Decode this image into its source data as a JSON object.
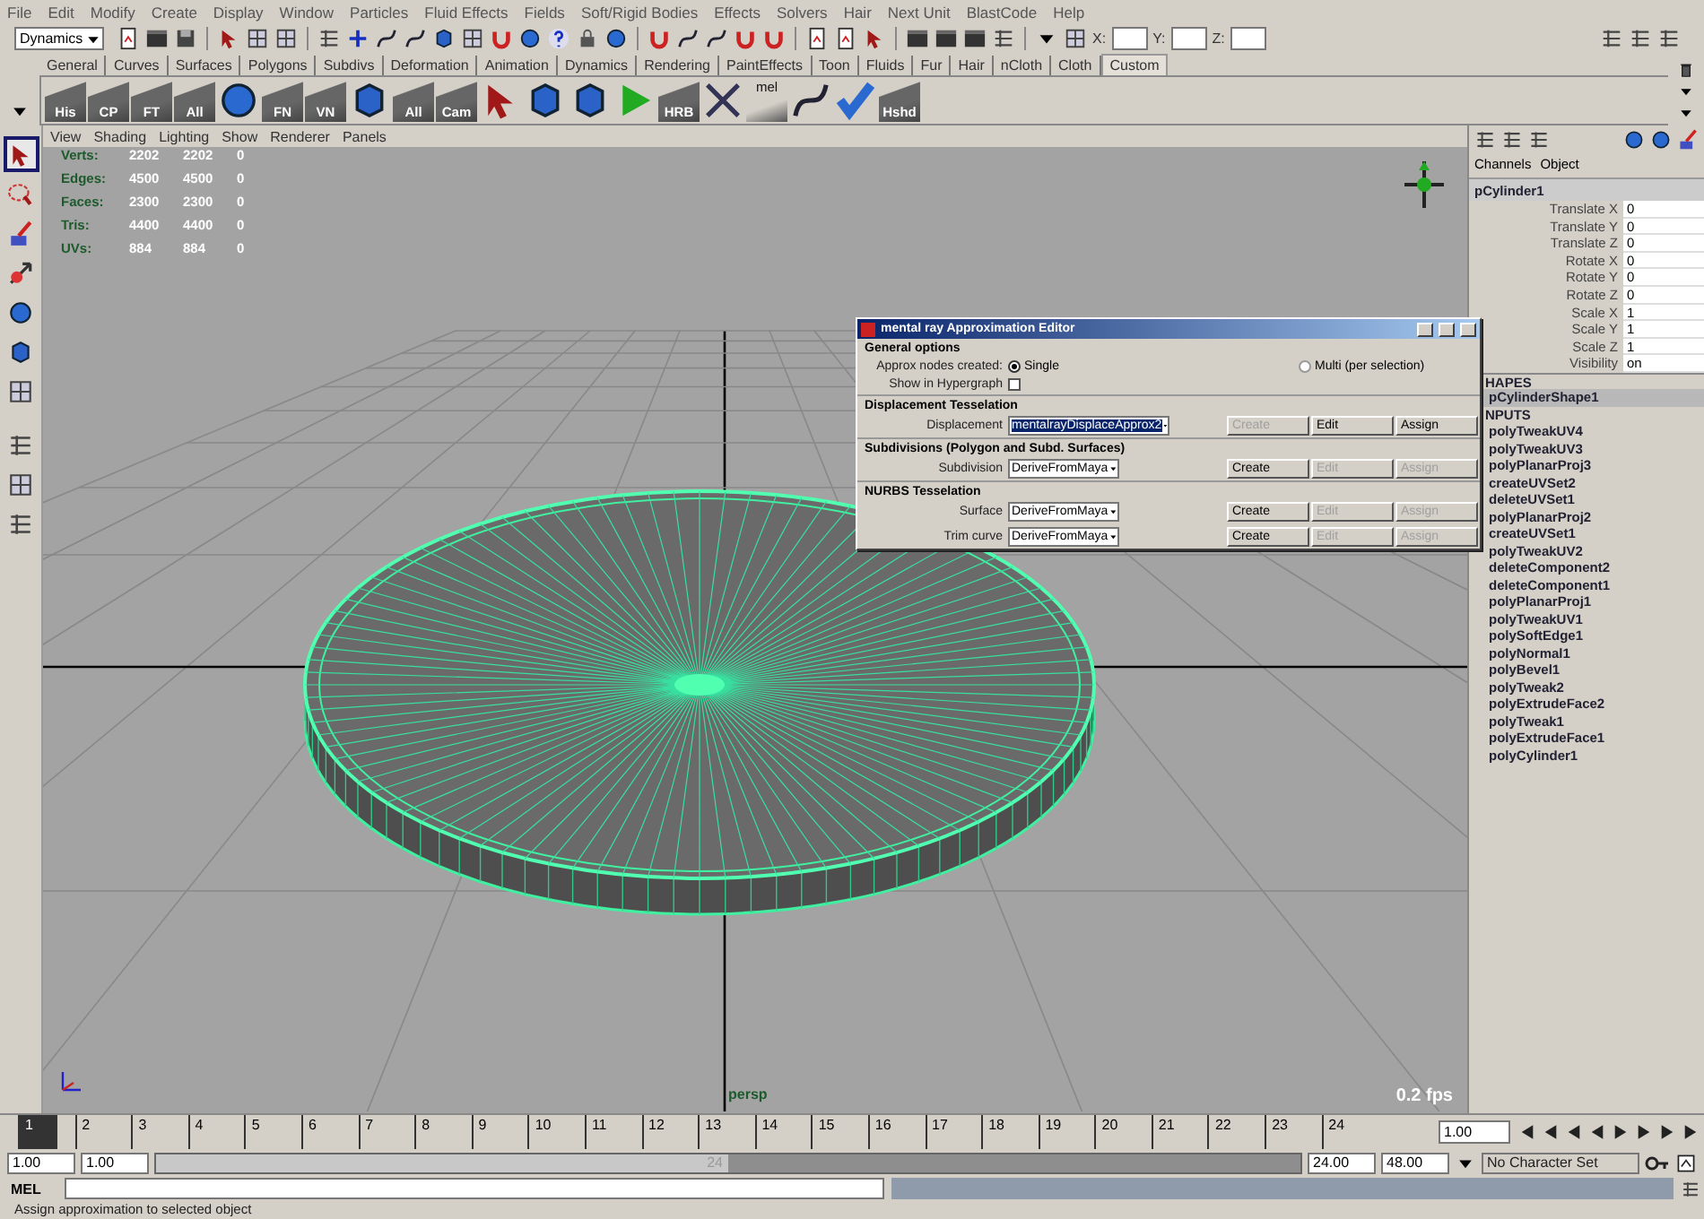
{
  "menu_bar": [
    "File",
    "Edit",
    "Modify",
    "Create",
    "Display",
    "Window",
    "Particles",
    "Fluid Effects",
    "Fields",
    "Soft/Rigid Bodies",
    "Effects",
    "Solvers",
    "Hair",
    "Next Unit",
    "BlastCode",
    "Help"
  ],
  "status_line": {
    "mode": "Dynamics",
    "fields": [
      {
        "label": "X:"
      },
      {
        "label": "Y:"
      },
      {
        "label": "Z:"
      }
    ]
  },
  "shelf": {
    "tabs": [
      {
        "label": "General",
        "selected": false
      },
      {
        "label": "Curves",
        "selected": false
      },
      {
        "label": "Surfaces",
        "selected": false
      },
      {
        "label": "Polygons",
        "selected": false
      },
      {
        "label": "Subdivs",
        "selected": false
      },
      {
        "label": "Deformation",
        "selected": false
      },
      {
        "label": "Animation",
        "selected": false
      },
      {
        "label": "Dynamics",
        "selected": false
      },
      {
        "label": "Rendering",
        "selected": false
      },
      {
        "label": "PaintEffects",
        "selected": false
      },
      {
        "label": "Toon",
        "selected": false
      },
      {
        "label": "Fluids",
        "selected": false
      },
      {
        "label": "Fur",
        "selected": false
      },
      {
        "label": "Hair",
        "selected": false
      },
      {
        "label": "nCloth",
        "selected": false
      },
      {
        "label": "Cloth",
        "selected": false
      },
      {
        "label": "Custom",
        "selected": true
      }
    ],
    "buttons": [
      {
        "kind": "labeled",
        "label": "His"
      },
      {
        "kind": "labeled",
        "label": "CP"
      },
      {
        "kind": "labeled",
        "label": "FT"
      },
      {
        "kind": "labeled",
        "label": "All"
      },
      {
        "kind": "icon"
      },
      {
        "kind": "labeled",
        "label": "FN"
      },
      {
        "kind": "labeled",
        "label": "VN"
      },
      {
        "kind": "icon"
      },
      {
        "kind": "labeled",
        "label": "All"
      },
      {
        "kind": "labeled",
        "label": "Cam"
      },
      {
        "kind": "icon"
      },
      {
        "kind": "icon"
      },
      {
        "kind": "icon"
      },
      {
        "kind": "icon"
      },
      {
        "kind": "labeled",
        "label": "HRB"
      },
      {
        "kind": "icon"
      },
      {
        "kind": "labeled",
        "label": "mel"
      },
      {
        "kind": "icon"
      },
      {
        "kind": "icon"
      },
      {
        "kind": "labeled",
        "label": "Hshd"
      }
    ]
  },
  "toolbox": [
    {
      "selected": true
    },
    {
      "selected": false
    },
    {
      "selected": false
    },
    {
      "selected": false
    },
    {
      "selected": false
    },
    {
      "selected": false
    },
    {
      "selected": false
    },
    {
      "selected": false
    },
    {
      "selected": false
    },
    {
      "selected": false
    }
  ],
  "viewport": {
    "panel_menu": [
      "View",
      "Shading",
      "Lighting",
      "Show",
      "Renderer",
      "Panels"
    ],
    "hud": [
      {
        "label": "Verts:",
        "values": [
          "2202",
          "2202",
          "0"
        ]
      },
      {
        "label": "Edges:",
        "values": [
          "4500",
          "4500",
          "0"
        ]
      },
      {
        "label": "Faces:",
        "values": [
          "2300",
          "2300",
          "0"
        ]
      },
      {
        "label": "Tris:",
        "values": [
          "4400",
          "4400",
          "0"
        ]
      },
      {
        "label": "UVs:",
        "values": [
          "884",
          "884",
          "0"
        ]
      }
    ],
    "camera": "persp",
    "fps": "0.2 fps"
  },
  "approximation_editor": {
    "title": "mental ray Approximation Editor",
    "general": {
      "heading": "General options",
      "approx_label": "Approx nodes created:",
      "options": [
        {
          "label": "Single",
          "selected": true
        },
        {
          "label": "Multi (per selection)",
          "selected": false
        }
      ],
      "hypergraph": {
        "label": "Show in Hypergraph",
        "checked": false
      }
    },
    "groups": [
      {
        "heading": "Displacement Tesselation",
        "rows": [
          {
            "label": "Displacement",
            "value": "mentalrayDisplaceApprox2",
            "highlighted": true,
            "buttons": [
              {
                "label": "Create",
                "disabled": true
              },
              {
                "label": "Edit",
                "disabled": false
              },
              {
                "label": "Assign",
                "disabled": false
              }
            ]
          }
        ]
      },
      {
        "heading": "Subdivisions (Polygon and Subd. Surfaces)",
        "rows": [
          {
            "label": "Subdivision",
            "value": "DeriveFromMaya",
            "highlighted": false,
            "buttons": [
              {
                "label": "Create",
                "disabled": false
              },
              {
                "label": "Edit",
                "disabled": true
              },
              {
                "label": "Assign",
                "disabled": true
              }
            ]
          }
        ]
      },
      {
        "heading": "NURBS Tesselation",
        "rows": [
          {
            "label": "Surface",
            "value": "DeriveFromMaya",
            "highlighted": false,
            "buttons": [
              {
                "label": "Create",
                "disabled": false
              },
              {
                "label": "Edit",
                "disabled": true
              },
              {
                "label": "Assign",
                "disabled": true
              }
            ]
          },
          {
            "label": "Trim curve",
            "value": "DeriveFromMaya",
            "highlighted": false,
            "buttons": [
              {
                "label": "Create",
                "disabled": false
              },
              {
                "label": "Edit",
                "disabled": true
              },
              {
                "label": "Assign",
                "disabled": true
              }
            ]
          }
        ]
      }
    ]
  },
  "channel_box": {
    "tabs": [
      "Channels",
      "Object"
    ],
    "node": "pCylinder1",
    "attributes": [
      {
        "name": "Translate X",
        "value": "0"
      },
      {
        "name": "Translate Y",
        "value": "0"
      },
      {
        "name": "Translate Z",
        "value": "0"
      },
      {
        "name": "Rotate X",
        "value": "0"
      },
      {
        "name": "Rotate Y",
        "value": "0"
      },
      {
        "name": "Rotate Z",
        "value": "0"
      },
      {
        "name": "Scale X",
        "value": "1"
      },
      {
        "name": "Scale Y",
        "value": "1"
      },
      {
        "name": "Scale Z",
        "value": "1"
      },
      {
        "name": "Visibility",
        "value": "on"
      }
    ],
    "shapes_heading": "HAPES",
    "shapes": [
      {
        "name": "pCylinderShape1",
        "selected": true
      }
    ],
    "inputs_heading": "NPUTS",
    "inputs": [
      "polyTweakUV4",
      "polyTweakUV3",
      "polyPlanarProj3",
      "createUVSet2",
      "deleteUVSet1",
      "polyPlanarProj2",
      "createUVSet1",
      "polyTweakUV2",
      "deleteComponent2",
      "deleteComponent1",
      "polyPlanarProj1",
      "polyTweakUV1",
      "polySoftEdge1",
      "polyNormal1",
      "polyBevel1",
      "polyTweak2",
      "polyExtrudeFace2",
      "polyTweak1",
      "polyExtrudeFace1",
      "polyCylinder1"
    ]
  },
  "time_slider": {
    "frames": [
      {
        "label": "1",
        "selected": true
      },
      {
        "label": "2",
        "selected": false
      },
      {
        "label": "3",
        "selected": false
      },
      {
        "label": "4",
        "selected": false
      },
      {
        "label": "5",
        "selected": false
      },
      {
        "label": "6",
        "selected": false
      },
      {
        "label": "7",
        "selected": false
      },
      {
        "label": "8",
        "selected": false
      },
      {
        "label": "9",
        "selected": false
      },
      {
        "label": "10",
        "selected": false
      },
      {
        "label": "11",
        "selected": false
      },
      {
        "label": "12",
        "selected": false
      },
      {
        "label": "13",
        "selected": false
      },
      {
        "label": "14",
        "selected": false
      },
      {
        "label": "15",
        "selected": false
      },
      {
        "label": "16",
        "selected": false
      },
      {
        "label": "17",
        "selected": false
      },
      {
        "label": "18",
        "selected": false
      },
      {
        "label": "19",
        "selected": false
      },
      {
        "label": "20",
        "selected": false
      },
      {
        "label": "21",
        "selected": false
      },
      {
        "label": "22",
        "selected": false
      },
      {
        "label": "23",
        "selected": false
      },
      {
        "label": "24",
        "selected": false
      }
    ],
    "current_time": "1.00"
  },
  "range_slider": {
    "start": "1.00",
    "range_start": "1.00",
    "handle_label": "24",
    "level": 0.5,
    "range_end": "24.00",
    "end": "48.00",
    "character_set": "No Character Set"
  },
  "command_line": {
    "label": "MEL"
  },
  "help_line": "Assign approximation to selected object"
}
